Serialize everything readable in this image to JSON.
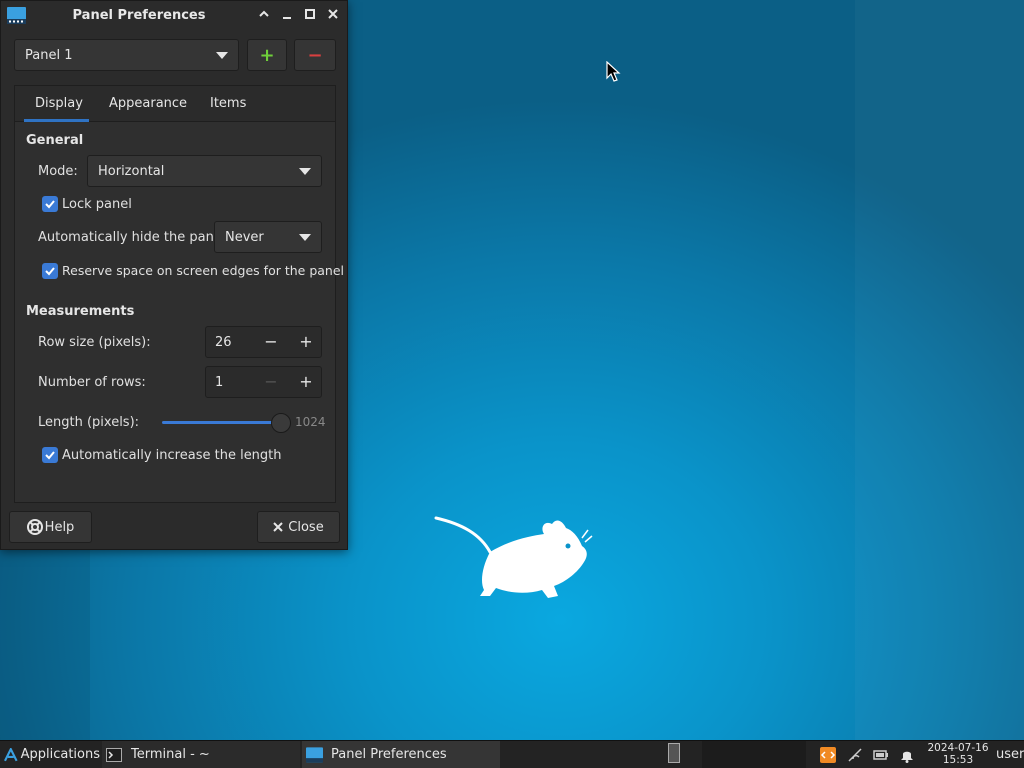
{
  "window": {
    "title": "Panel Preferences",
    "panel_select": "Panel 1",
    "add_symbol": "+",
    "remove_symbol": "−"
  },
  "tabs": [
    {
      "label": "Display",
      "active": true
    },
    {
      "label": "Appearance",
      "active": false
    },
    {
      "label": "Items",
      "active": false
    }
  ],
  "general": {
    "heading": "General",
    "mode_label": "Mode:",
    "mode_value": "Horizontal",
    "lock_panel": {
      "label": "Lock panel",
      "checked": true
    },
    "autohide_label": "Automatically hide the panel:",
    "autohide_value": "Never",
    "reserve_space": {
      "label": "Reserve space on screen edges for the panel",
      "checked": true
    }
  },
  "measurements": {
    "heading": "Measurements",
    "row_size_label": "Row size (pixels):",
    "row_size_value": "26",
    "rows_label": "Number of rows:",
    "rows_value": "1",
    "length_label": "Length (pixels):",
    "length_value": "1024",
    "length_fraction": 1.0,
    "auto_increase": {
      "label": "Automatically increase the length",
      "checked": true
    }
  },
  "footer": {
    "help_label": "Help",
    "close_label": "Close"
  },
  "taskbar": {
    "applications_label": "Applications",
    "terminal_label": "Terminal - ~",
    "panel_prefs_label": "Panel Preferences",
    "date": "2024-07-16",
    "time": "15:53",
    "user": "user"
  },
  "colors": {
    "accent": "#3a7ad6",
    "window_bg": "#2b2b2b",
    "desktop": "#0a93c9",
    "add_green": "#6fcf3a",
    "remove_red": "#d94040"
  }
}
